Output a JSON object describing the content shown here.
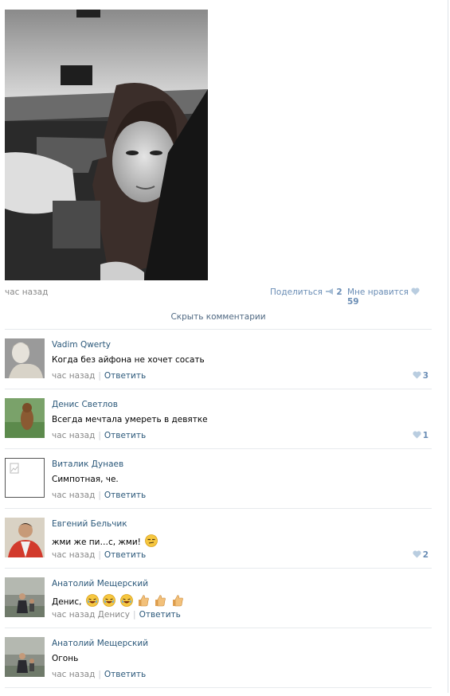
{
  "post": {
    "top_fragment": "",
    "time": "час назад",
    "share_label": "Поделиться",
    "share_count": "2",
    "like_label": "Мне нравится",
    "like_count": "59"
  },
  "comments_toggle": "Скрыть комментарии",
  "comments": [
    {
      "name": "Vadim Qwerty",
      "text": "Когда без айфона не хочет сосать",
      "time": "час назад",
      "reply_to": "",
      "reply": "Ответить",
      "likes": "3"
    },
    {
      "name": "Денис Светлов",
      "text": "Всегда мечтала умереть в девятке",
      "time": "час назад",
      "reply_to": "",
      "reply": "Ответить",
      "likes": "1"
    },
    {
      "name": "Виталик Дунаев",
      "text": "Симпотная, че.",
      "time": "час назад",
      "reply_to": "",
      "reply": "Ответить",
      "likes": ""
    },
    {
      "name": "Евгений Бельчик",
      "text": "жми же пи…с, жми!",
      "time": "час назад",
      "reply_to": "",
      "reply": "Ответить",
      "likes": "2"
    },
    {
      "name": "Анатолий Мещерский",
      "text": "Денис,",
      "time": "час назад",
      "reply_to": "Денису",
      "reply": "Ответить",
      "likes": ""
    },
    {
      "name": "Анатолий Мещерский",
      "text": "Огонь",
      "time": "час назад",
      "reply_to": "",
      "reply": "Ответить",
      "likes": ""
    }
  ],
  "colors": {
    "link": "#2b587a",
    "like": "#6a8db5",
    "muted": "#888888",
    "divider": "#e7eaed"
  }
}
